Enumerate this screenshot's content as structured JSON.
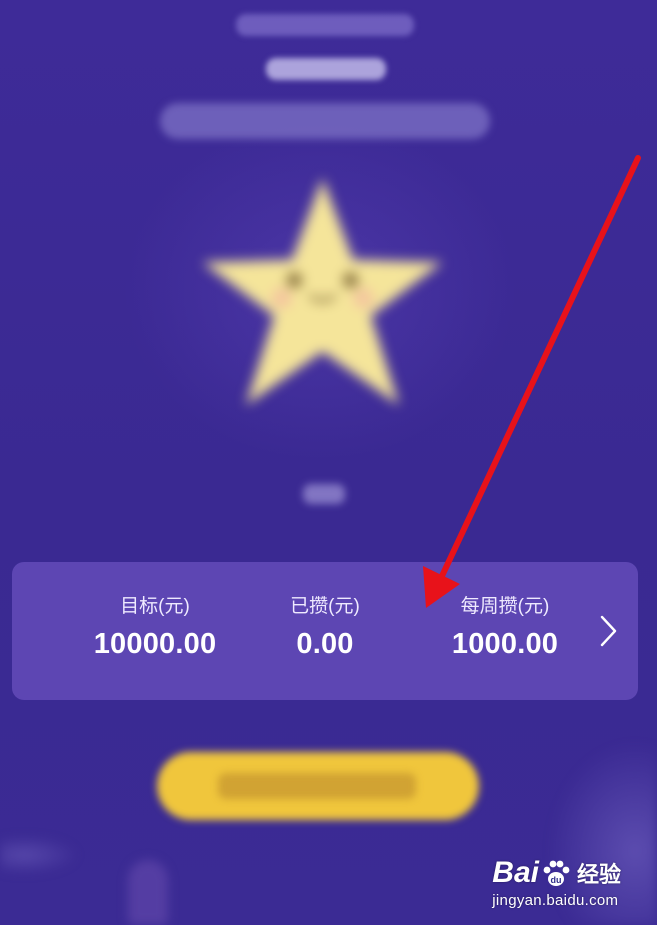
{
  "savings_card": {
    "columns": [
      {
        "label": "目标(元)",
        "value": "10000.00"
      },
      {
        "label": "已攒(元)",
        "value": "0.00"
      },
      {
        "label": "每周攒(元)",
        "value": "1000.00"
      }
    ],
    "chevron_icon": "chevron-right-icon"
  },
  "annotation": {
    "arrow_color": "#e8121a",
    "icon": "red-arrow-icon"
  },
  "watermark": {
    "brand_left": "Bai",
    "brand_right": "du",
    "product": "经验",
    "url": "jingyan.baidu.com",
    "icon": "paw-icon"
  },
  "colors": {
    "background": "#3b2a93",
    "card": "#5d46b3",
    "star": "#f5e59a",
    "cta": "#f0c63c"
  }
}
